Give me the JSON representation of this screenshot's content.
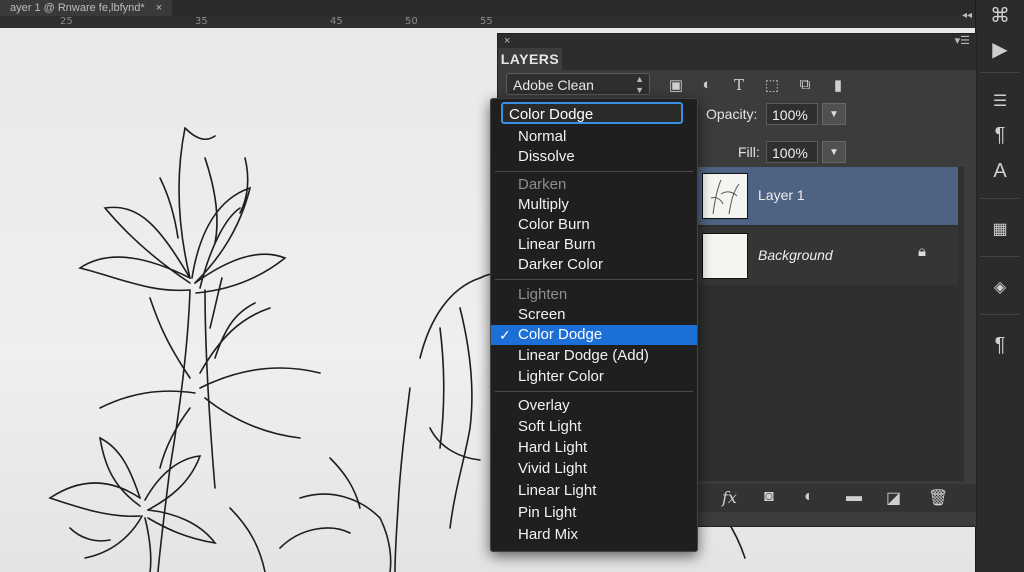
{
  "document": {
    "tab_title": "ayer 1 @ Rnware fe,lbfynd*",
    "tab_close": "×",
    "ruler_numbers": [
      "25",
      "35",
      "45",
      "50",
      "55"
    ]
  },
  "layers_panel": {
    "close_label": "×",
    "tab_label": "LAYERS",
    "panel_menu_icon": "panel-menu-icon",
    "collapse_icon": "collapse-icon",
    "filter_kind": "Adobe Clean",
    "filter_icons": [
      "image-filter-icon",
      "adjustment-filter-icon",
      "type-filter-icon",
      "shape-filter-icon",
      "smartobject-filter-icon",
      "filter-toggle-icon"
    ],
    "opacity_label": "Opacity:",
    "opacity_value": "100%",
    "fill_label": "Fill:",
    "fill_value": "100%",
    "layers": [
      {
        "name": "Layer 1",
        "selected": true
      },
      {
        "name": "Background",
        "selected": false,
        "locked": true
      }
    ],
    "bottom_icons": [
      "fx-icon",
      "mask-icon",
      "adjustment-icon",
      "folder-icon",
      "new-layer-icon",
      "trash-icon"
    ],
    "fx_label": "fx"
  },
  "blend_menu": {
    "current": "Color Dodge",
    "groups": [
      {
        "items": [
          "Normal",
          "Dissolve"
        ]
      },
      {
        "header": "Darken",
        "items": [
          "Multiply",
          "Color Burn",
          "Linear Burn",
          "Darker Color"
        ]
      },
      {
        "header": "Lighten",
        "items": [
          "Screen",
          "Color Dodge",
          "Linear Dodge (Add)",
          "Lighter Color"
        ]
      },
      {
        "items": [
          "Overlay",
          "Soft Light",
          "Hard Light",
          "Vivid Light",
          "Linear Light",
          "Pin Light",
          "Hard Mix"
        ]
      }
    ],
    "selected": "Color Dodge",
    "check_mark": "✓"
  },
  "colors": {
    "selection_blue": "#1d6fd8",
    "focus_ring": "#3a8ee6",
    "layer_selected": "#4e6283"
  }
}
